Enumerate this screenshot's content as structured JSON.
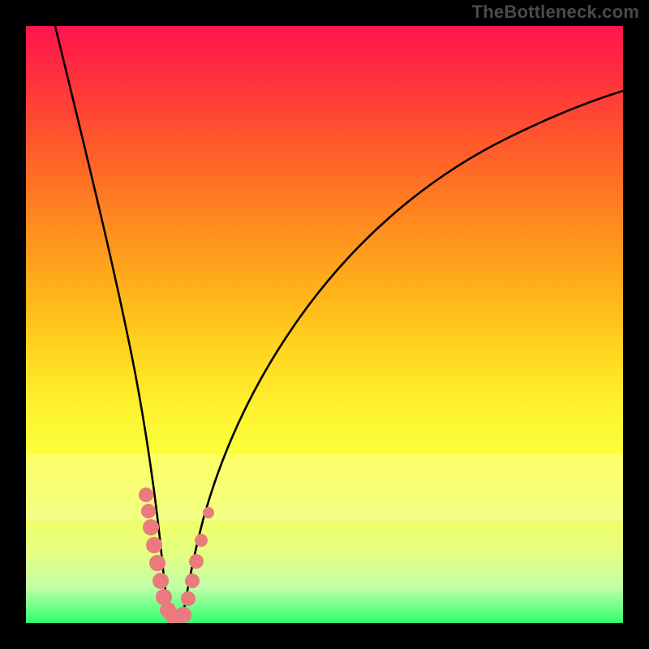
{
  "watermark": "TheBottleneck.com",
  "chart_data": {
    "type": "line",
    "title": "",
    "xlabel": "",
    "ylabel": "",
    "xlim": [
      0,
      100
    ],
    "ylim": [
      0,
      100
    ],
    "series": [
      {
        "name": "left-curve",
        "x": [
          5,
          7,
          10,
          13,
          15,
          17,
          18.5,
          20,
          21,
          22,
          22.5,
          23
        ],
        "y": [
          100,
          80,
          58,
          42,
          33,
          24,
          18,
          13,
          9,
          5,
          3,
          0
        ]
      },
      {
        "name": "right-curve",
        "x": [
          25,
          26,
          27,
          28.5,
          30,
          32,
          35,
          40,
          47,
          56,
          68,
          82,
          100
        ],
        "y": [
          0,
          4,
          8,
          13,
          18,
          25,
          33,
          44,
          55,
          65,
          74,
          81,
          87
        ]
      }
    ],
    "markers": {
      "name": "highlighted-points",
      "color": "#ea7a7d",
      "points_xy": [
        [
          19.2,
          21.5
        ],
        [
          19.8,
          19
        ],
        [
          20.3,
          16.5
        ],
        [
          20.8,
          14
        ],
        [
          21.5,
          10.5
        ],
        [
          22.1,
          7.5
        ],
        [
          22.6,
          5
        ],
        [
          23,
          3
        ],
        [
          23.4,
          1.8
        ],
        [
          24.8,
          1.6
        ],
        [
          26.2,
          5
        ],
        [
          26.9,
          8
        ],
        [
          27.6,
          11
        ],
        [
          28.4,
          14
        ],
        [
          29.6,
          19
        ]
      ]
    },
    "gradient_stops": [
      {
        "pos": 0.0,
        "color": "#ff1450"
      },
      {
        "pos": 0.5,
        "color": "#ffd720"
      },
      {
        "pos": 1.0,
        "color": "#2fff70"
      }
    ],
    "pale_band_y": [
      18,
      28
    ]
  }
}
